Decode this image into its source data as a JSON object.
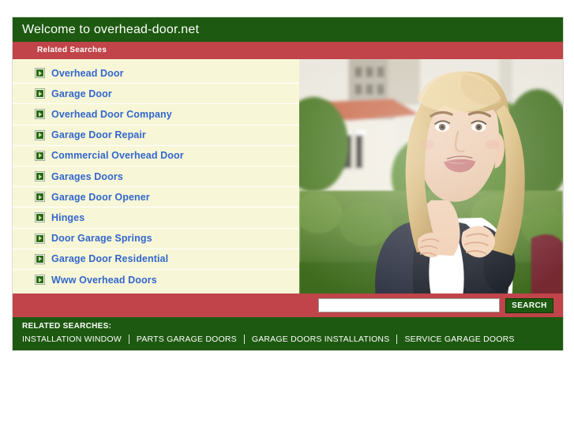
{
  "header": {
    "title": "Welcome to overhead-door.net",
    "subtitle": "Related Searches"
  },
  "related_searches": [
    {
      "label": "Overhead Door"
    },
    {
      "label": "Garage Door"
    },
    {
      "label": "Overhead Door Company"
    },
    {
      "label": "Garage Door Repair"
    },
    {
      "label": "Commercial Overhead Door"
    },
    {
      "label": "Garages Doors"
    },
    {
      "label": "Garage Door Opener"
    },
    {
      "label": "Hinges"
    },
    {
      "label": "Door Garage Springs"
    },
    {
      "label": "Garage Door Residential"
    },
    {
      "label": "Www Overhead Doors"
    }
  ],
  "search": {
    "value": "",
    "placeholder": "",
    "button_label": "SEARCH"
  },
  "footer": {
    "title": "RELATED SEARCHES:",
    "links": [
      {
        "label": "INSTALLATION WINDOW"
      },
      {
        "label": "PARTS GARAGE DOORS"
      },
      {
        "label": "GARAGE DOORS INSTALLATIONS"
      },
      {
        "label": "SERVICE GARAGE DOORS"
      }
    ]
  },
  "photo": {
    "alt": "Smiling blonde young woman wearing a backpack outdoors in front of a building"
  },
  "colors": {
    "green": "#1d5910",
    "red": "#c0444a",
    "cream": "#f7f7d8",
    "link_blue": "#3366cc"
  }
}
